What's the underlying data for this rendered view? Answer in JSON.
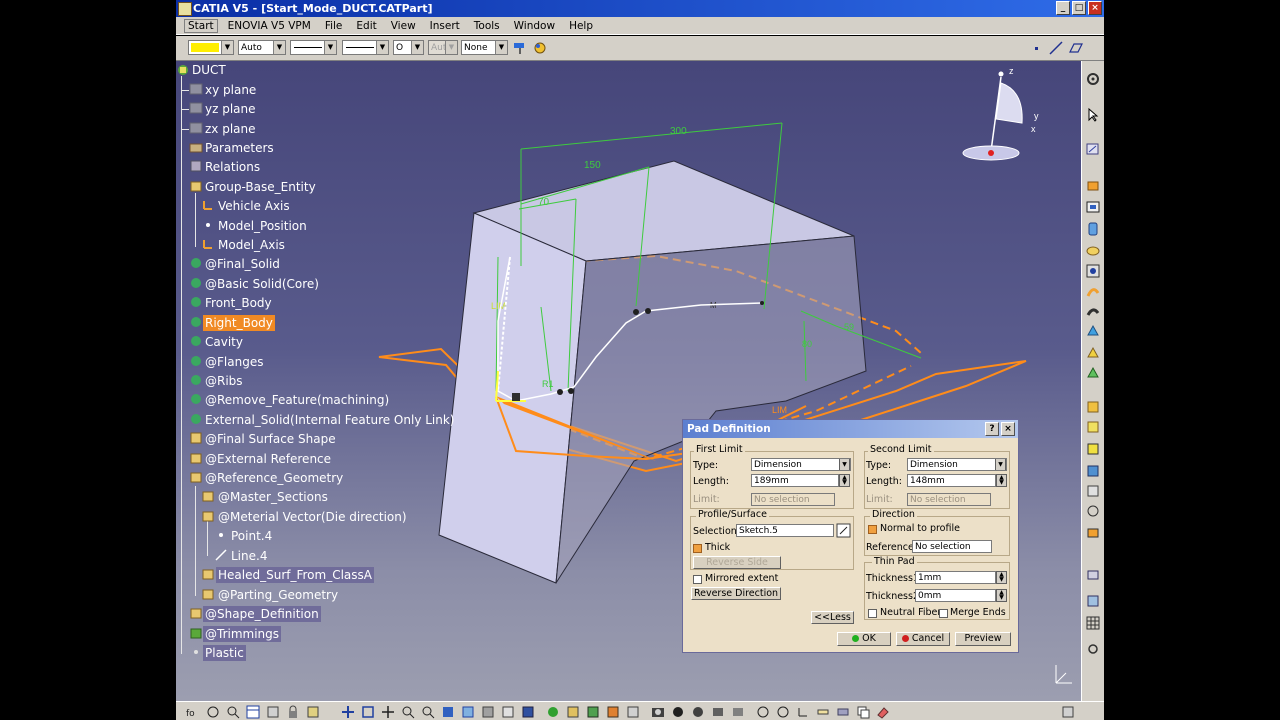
{
  "window": {
    "title": "CATIA V5 - [Start_Mode_DUCT.CATPart]"
  },
  "menu": [
    "Start",
    "ENOVIA V5 VPM",
    "File",
    "Edit",
    "View",
    "Insert",
    "Tools",
    "Window",
    "Help"
  ],
  "toolbar": {
    "line_type": "Auto",
    "point_combo": "O",
    "aut_combo": "Aut",
    "layer_combo": "None"
  },
  "tree": [
    {
      "label": "DUCT",
      "style": "root"
    },
    {
      "label": "xy plane"
    },
    {
      "label": "yz plane"
    },
    {
      "label": "zx plane"
    },
    {
      "label": "Parameters"
    },
    {
      "label": "Relations"
    },
    {
      "label": "Group-Base_Entity"
    },
    {
      "label": "Vehicle Axis"
    },
    {
      "label": "Model_Position"
    },
    {
      "label": "Model_Axis"
    },
    {
      "label": "@Final_Solid"
    },
    {
      "label": "@Basic Solid(Core)"
    },
    {
      "label": "Front_Body"
    },
    {
      "label": "Right_Body",
      "style": "orange"
    },
    {
      "label": "Cavity"
    },
    {
      "label": "@Flanges"
    },
    {
      "label": "@Ribs"
    },
    {
      "label": "@Remove_Feature(machining)"
    },
    {
      "label": "External_Solid(Internal Feature Only Link)"
    },
    {
      "label": "@Final Surface Shape"
    },
    {
      "label": "@External Reference"
    },
    {
      "label": "@Reference_Geometry"
    },
    {
      "label": "@Master_Sections"
    },
    {
      "label": "@Meterial Vector(Die direction)"
    },
    {
      "label": "Point.4"
    },
    {
      "label": "Line.4"
    },
    {
      "label": "Healed_Surf_From_ClassA",
      "style": "hl"
    },
    {
      "label": "@Parting_Geometry"
    },
    {
      "label": "@Shape_Definition",
      "style": "hl"
    },
    {
      "label": "@Trimmings",
      "style": "hl"
    },
    {
      "label": "Plastic",
      "style": "hl"
    }
  ],
  "model": {
    "dim_300": "300",
    "dim_150": "150",
    "dim_70": "70",
    "dim_limit1": "LIM",
    "dim_limit2": "LIM",
    "dim_59": "59",
    "dim_80": "80",
    "dim_r_small": "R1",
    "point_label": "M",
    "compass_z": "z",
    "compass_y": "y",
    "compass_x": "x"
  },
  "pad": {
    "title": "Pad Definition",
    "first_limit": "First Limit",
    "type_label": "Type:",
    "type1": "Dimension",
    "length_label": "Length:",
    "length1": "189mm",
    "limit_label": "Limit:",
    "limit1": "No selection",
    "profile_surface": "Profile/Surface",
    "selection_label": "Selection:",
    "selection": "Sketch.5",
    "thick": "Thick",
    "reverse_side": "Reverse Side",
    "mirrored_extent": "Mirrored extent",
    "reverse_direction": "Reverse Direction",
    "less": "<<Less",
    "second_limit": "Second Limit",
    "type2": "Dimension",
    "length2": "148mm",
    "limit2": "No selection",
    "direction": "Direction",
    "normal_to_profile": "Normal to profile",
    "reference_label": "Reference:",
    "reference": "No selection",
    "thin_pad": "Thin Pad",
    "thickness1_label": "Thickness1:",
    "thickness1": "1mm",
    "thickness2_label": "Thickness2:",
    "thickness2": "0mm",
    "neutral_fiber": "Neutral Fiber",
    "merge_ends": "Merge Ends",
    "ok": "OK",
    "cancel": "Cancel",
    "preview": "Preview"
  },
  "colors": {
    "accent_orange": "#f08a24",
    "dim_green": "#3ecb3e",
    "viewport_top": "#46467a"
  }
}
